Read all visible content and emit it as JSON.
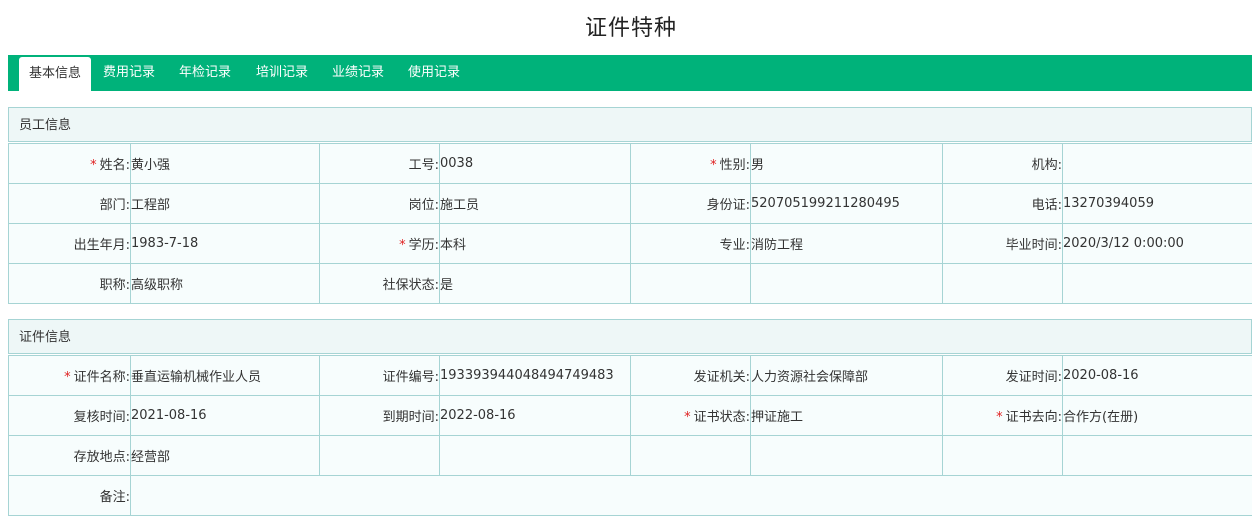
{
  "page": {
    "title": "证件特种"
  },
  "tabs": [
    {
      "label": "基本信息",
      "active": true
    },
    {
      "label": "费用记录"
    },
    {
      "label": "年检记录"
    },
    {
      "label": "培训记录"
    },
    {
      "label": "业绩记录"
    },
    {
      "label": "使用记录"
    }
  ],
  "required_mark": "*",
  "employee": {
    "section_title": "员工信息",
    "name": {
      "label": "姓名:",
      "value": "黄小强"
    },
    "number": {
      "label": "工号:",
      "value": "0038"
    },
    "gender": {
      "label": "性别:",
      "value": "男"
    },
    "org": {
      "label": "机构:",
      "value": ""
    },
    "dept": {
      "label": "部门:",
      "value": "工程部"
    },
    "position": {
      "label": "岗位:",
      "value": "施工员"
    },
    "id_card": {
      "label": "身份证:",
      "value": "520705199211280495"
    },
    "phone": {
      "label": "电话:",
      "value": "13270394059"
    },
    "birth": {
      "label": "出生年月:",
      "value": "1983-7-18"
    },
    "education": {
      "label": "学历:",
      "value": "本科"
    },
    "major": {
      "label": "专业:",
      "value": "消防工程"
    },
    "grad_time": {
      "label": "毕业时间:",
      "value": "2020/3/12 0:00:00"
    },
    "title": {
      "label": "职称:",
      "value": "高级职称"
    },
    "social": {
      "label": "社保状态:",
      "value": "是"
    }
  },
  "certificate": {
    "section_title": "证件信息",
    "cert_name": {
      "label": "证件名称:",
      "value": "垂直运输机械作业人员"
    },
    "cert_no": {
      "label": "证件编号:",
      "value": "193393944048494749483"
    },
    "issuer": {
      "label": "发证机关:",
      "value": "人力资源社会保障部"
    },
    "issue_date": {
      "label": "发证时间:",
      "value": "2020-08-16"
    },
    "review_date": {
      "label": "复核时间:",
      "value": "2021-08-16"
    },
    "expire_date": {
      "label": "到期时间:",
      "value": "2022-08-16"
    },
    "status": {
      "label": "证书状态:",
      "value": "押证施工"
    },
    "direction": {
      "label": "证书去向:",
      "value": "合作方(在册)"
    },
    "location": {
      "label": "存放地点:",
      "value": "经营部"
    },
    "remark": {
      "label": "备注:",
      "value": ""
    }
  }
}
